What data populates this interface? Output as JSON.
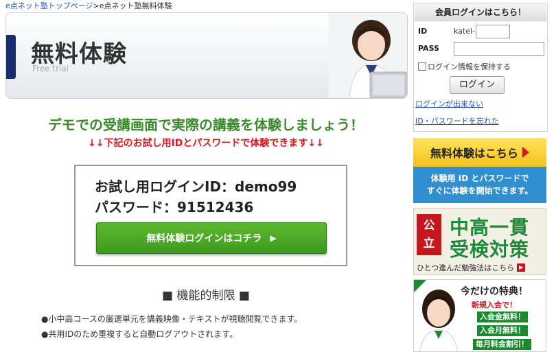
{
  "breadcrumb": {
    "home": "e点ネット塾トップページ",
    "separator": ">",
    "current": "e点ネット塾無料体験"
  },
  "hero": {
    "title": "無料体験",
    "subtitle": "Free trial"
  },
  "demo": {
    "heading": "デモでの受講画面で実際の講義を体験しましょう！",
    "subheading": "↓↓下記のお試し用IDとパスワードで体験できます↓↓",
    "trial_id": "お試し用ログインID：demo99",
    "trial_password": "パスワード：91512436",
    "login_button": "無料体験ログインはコチラ",
    "play_glyph": "▶"
  },
  "features": {
    "title": "■ 機能的制限 ■",
    "items": [
      "小中高コースの厳選単元を講義映像・テキストが視聴閲覧できます。",
      "共用IDのため重複すると自動ログアウトされます。"
    ]
  },
  "member_login": {
    "header": "会員ログインはこちら！",
    "id_label": "ID",
    "id_prefix": "katei-",
    "id_value": "",
    "pass_label": "PASS",
    "pass_value": "",
    "remember_label": "ログイン情報を保持する",
    "login_button": "ログイン",
    "cannot_login_link": "ログインが出来ない",
    "forgot_link": "ID・パスワードを忘れた"
  },
  "banner_trial": {
    "title": "無料体験はこちら",
    "line1": "体験用 ID とパスワードで",
    "line2": "すぐに体験を開始できます。"
  },
  "banner_koritsu": {
    "badge_top": "公",
    "badge_bottom": "立",
    "line1": "中高一貫",
    "line2": "受検対策",
    "footer": "ひとつ進んだ勉強法はこちら",
    "play_glyph": "▶"
  },
  "banner_offer": {
    "title": "今だけの特典！",
    "tag1": "新規入会で！",
    "tag2": "入会金無料！",
    "tag3": "入会月無料！",
    "tag4": "毎月料金割引！"
  },
  "colors": {
    "green_heading": "#3a8a2a",
    "red_text": "#e0141e",
    "button_green": "#4aa626",
    "link_blue": "#2255aa",
    "banner_yellow": "#f4c21d",
    "banner_blue": "#2f8fd0"
  }
}
